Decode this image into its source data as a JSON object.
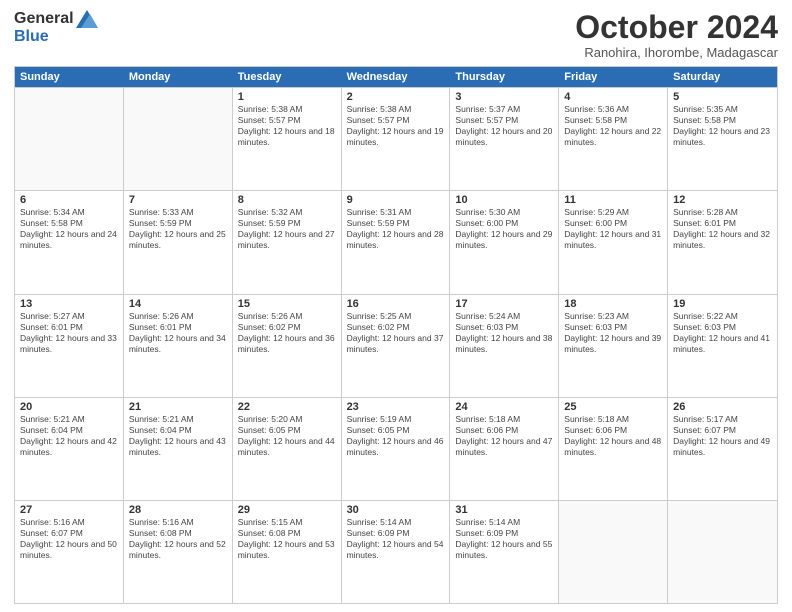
{
  "logo": {
    "general": "General",
    "blue": "Blue"
  },
  "title": "October 2024",
  "subtitle": "Ranohira, Ihorombe, Madagascar",
  "days": [
    "Sunday",
    "Monday",
    "Tuesday",
    "Wednesday",
    "Thursday",
    "Friday",
    "Saturday"
  ],
  "weeks": [
    [
      {
        "day": "",
        "info": ""
      },
      {
        "day": "",
        "info": ""
      },
      {
        "day": "1",
        "info": "Sunrise: 5:38 AM\nSunset: 5:57 PM\nDaylight: 12 hours and 18 minutes."
      },
      {
        "day": "2",
        "info": "Sunrise: 5:38 AM\nSunset: 5:57 PM\nDaylight: 12 hours and 19 minutes."
      },
      {
        "day": "3",
        "info": "Sunrise: 5:37 AM\nSunset: 5:57 PM\nDaylight: 12 hours and 20 minutes."
      },
      {
        "day": "4",
        "info": "Sunrise: 5:36 AM\nSunset: 5:58 PM\nDaylight: 12 hours and 22 minutes."
      },
      {
        "day": "5",
        "info": "Sunrise: 5:35 AM\nSunset: 5:58 PM\nDaylight: 12 hours and 23 minutes."
      }
    ],
    [
      {
        "day": "6",
        "info": "Sunrise: 5:34 AM\nSunset: 5:58 PM\nDaylight: 12 hours and 24 minutes."
      },
      {
        "day": "7",
        "info": "Sunrise: 5:33 AM\nSunset: 5:59 PM\nDaylight: 12 hours and 25 minutes."
      },
      {
        "day": "8",
        "info": "Sunrise: 5:32 AM\nSunset: 5:59 PM\nDaylight: 12 hours and 27 minutes."
      },
      {
        "day": "9",
        "info": "Sunrise: 5:31 AM\nSunset: 5:59 PM\nDaylight: 12 hours and 28 minutes."
      },
      {
        "day": "10",
        "info": "Sunrise: 5:30 AM\nSunset: 6:00 PM\nDaylight: 12 hours and 29 minutes."
      },
      {
        "day": "11",
        "info": "Sunrise: 5:29 AM\nSunset: 6:00 PM\nDaylight: 12 hours and 31 minutes."
      },
      {
        "day": "12",
        "info": "Sunrise: 5:28 AM\nSunset: 6:01 PM\nDaylight: 12 hours and 32 minutes."
      }
    ],
    [
      {
        "day": "13",
        "info": "Sunrise: 5:27 AM\nSunset: 6:01 PM\nDaylight: 12 hours and 33 minutes."
      },
      {
        "day": "14",
        "info": "Sunrise: 5:26 AM\nSunset: 6:01 PM\nDaylight: 12 hours and 34 minutes."
      },
      {
        "day": "15",
        "info": "Sunrise: 5:26 AM\nSunset: 6:02 PM\nDaylight: 12 hours and 36 minutes."
      },
      {
        "day": "16",
        "info": "Sunrise: 5:25 AM\nSunset: 6:02 PM\nDaylight: 12 hours and 37 minutes."
      },
      {
        "day": "17",
        "info": "Sunrise: 5:24 AM\nSunset: 6:03 PM\nDaylight: 12 hours and 38 minutes."
      },
      {
        "day": "18",
        "info": "Sunrise: 5:23 AM\nSunset: 6:03 PM\nDaylight: 12 hours and 39 minutes."
      },
      {
        "day": "19",
        "info": "Sunrise: 5:22 AM\nSunset: 6:03 PM\nDaylight: 12 hours and 41 minutes."
      }
    ],
    [
      {
        "day": "20",
        "info": "Sunrise: 5:21 AM\nSunset: 6:04 PM\nDaylight: 12 hours and 42 minutes."
      },
      {
        "day": "21",
        "info": "Sunrise: 5:21 AM\nSunset: 6:04 PM\nDaylight: 12 hours and 43 minutes."
      },
      {
        "day": "22",
        "info": "Sunrise: 5:20 AM\nSunset: 6:05 PM\nDaylight: 12 hours and 44 minutes."
      },
      {
        "day": "23",
        "info": "Sunrise: 5:19 AM\nSunset: 6:05 PM\nDaylight: 12 hours and 46 minutes."
      },
      {
        "day": "24",
        "info": "Sunrise: 5:18 AM\nSunset: 6:06 PM\nDaylight: 12 hours and 47 minutes."
      },
      {
        "day": "25",
        "info": "Sunrise: 5:18 AM\nSunset: 6:06 PM\nDaylight: 12 hours and 48 minutes."
      },
      {
        "day": "26",
        "info": "Sunrise: 5:17 AM\nSunset: 6:07 PM\nDaylight: 12 hours and 49 minutes."
      }
    ],
    [
      {
        "day": "27",
        "info": "Sunrise: 5:16 AM\nSunset: 6:07 PM\nDaylight: 12 hours and 50 minutes."
      },
      {
        "day": "28",
        "info": "Sunrise: 5:16 AM\nSunset: 6:08 PM\nDaylight: 12 hours and 52 minutes."
      },
      {
        "day": "29",
        "info": "Sunrise: 5:15 AM\nSunset: 6:08 PM\nDaylight: 12 hours and 53 minutes."
      },
      {
        "day": "30",
        "info": "Sunrise: 5:14 AM\nSunset: 6:09 PM\nDaylight: 12 hours and 54 minutes."
      },
      {
        "day": "31",
        "info": "Sunrise: 5:14 AM\nSunset: 6:09 PM\nDaylight: 12 hours and 55 minutes."
      },
      {
        "day": "",
        "info": ""
      },
      {
        "day": "",
        "info": ""
      }
    ]
  ]
}
